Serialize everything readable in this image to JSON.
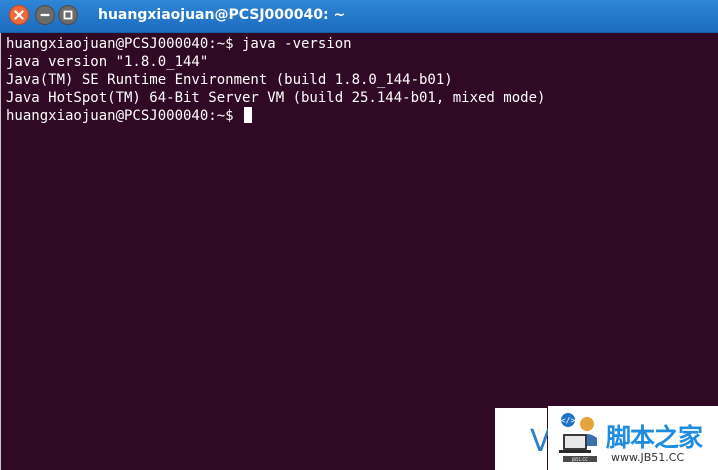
{
  "window": {
    "title": "huangxiaojuan@PCSJ000040: ~",
    "colors": {
      "terminal_bg": "#300a24",
      "titlebar_bg": "#1f72c7",
      "close_button": "#f0683c",
      "text": "#ffffff"
    }
  },
  "controls": {
    "close_icon": "close-icon",
    "minimize_icon": "minimize-icon",
    "maximize_icon": "maximize-icon"
  },
  "terminal": {
    "lines": [
      "huangxiaojuan@PCSJ000040:~$ java -version",
      "java version \"1.8.0_144\"",
      "Java(TM) SE Runtime Environment (build 1.8.0_144-b01)",
      "Java HotSpot(TM) 64-Bit Server VM (build 25.144-b01, mixed mode)",
      "huangxiaojuan@PCSJ000040:~$ "
    ]
  },
  "watermark": {
    "letter": "V",
    "brand": "脚本之家",
    "url": "www.JB51.CC",
    "logo_icon": "laptop-code-icon"
  }
}
